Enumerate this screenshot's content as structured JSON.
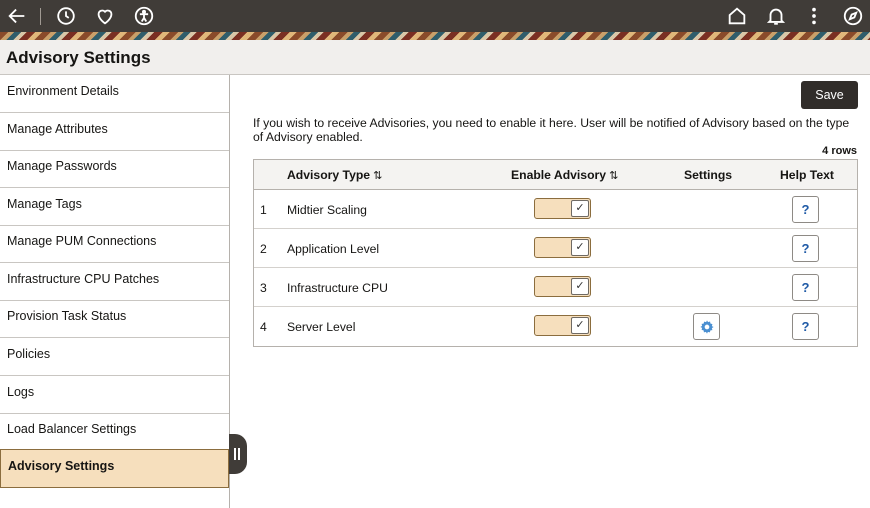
{
  "topbar": {
    "left_icons": [
      "back-arrow-icon",
      "recent-history-icon",
      "favorites-heart-icon",
      "accessibility-icon"
    ],
    "right_icons": [
      "home-icon",
      "notifications-bell-icon",
      "actions-menu-icon",
      "navigator-compass-icon"
    ]
  },
  "page": {
    "title": "Advisory Settings"
  },
  "sidebar": {
    "items": [
      {
        "label": "Environment Details"
      },
      {
        "label": "Manage Attributes"
      },
      {
        "label": "Manage Passwords"
      },
      {
        "label": "Manage Tags"
      },
      {
        "label": "Manage PUM Connections"
      },
      {
        "label": "Infrastructure CPU Patches"
      },
      {
        "label": "Provision Task Status"
      },
      {
        "label": "Policies"
      },
      {
        "label": "Logs"
      },
      {
        "label": "Load Balancer Settings"
      },
      {
        "label": "Advisory Settings",
        "active": true
      }
    ]
  },
  "toolbar": {
    "save_label": "Save"
  },
  "main": {
    "info_text": "If you wish to receive Advisories, you need to enable it here. User will be notified of Advisory based on the type of Advisory enabled.",
    "row_count": "4 rows",
    "grid": {
      "headers": {
        "advisory_type": "Advisory Type",
        "enable_advisory": "Enable Advisory",
        "settings": "Settings",
        "help_text": "Help Text",
        "sort_glyph": "⇅"
      },
      "rows": [
        {
          "num": "1",
          "type": "Midtier Scaling",
          "enabled": true,
          "has_settings": false,
          "help": "?"
        },
        {
          "num": "2",
          "type": "Application Level",
          "enabled": true,
          "has_settings": false,
          "help": "?"
        },
        {
          "num": "3",
          "type": "Infrastructure CPU",
          "enabled": true,
          "has_settings": false,
          "help": "?"
        },
        {
          "num": "4",
          "type": "Server Level",
          "enabled": true,
          "has_settings": true,
          "help": "?"
        }
      ]
    }
  },
  "colors": {
    "banner": "#403c38",
    "active_item_bg": "#f6dfbd",
    "save_button": "#312d2a",
    "help_link": "#1f5aa6"
  }
}
